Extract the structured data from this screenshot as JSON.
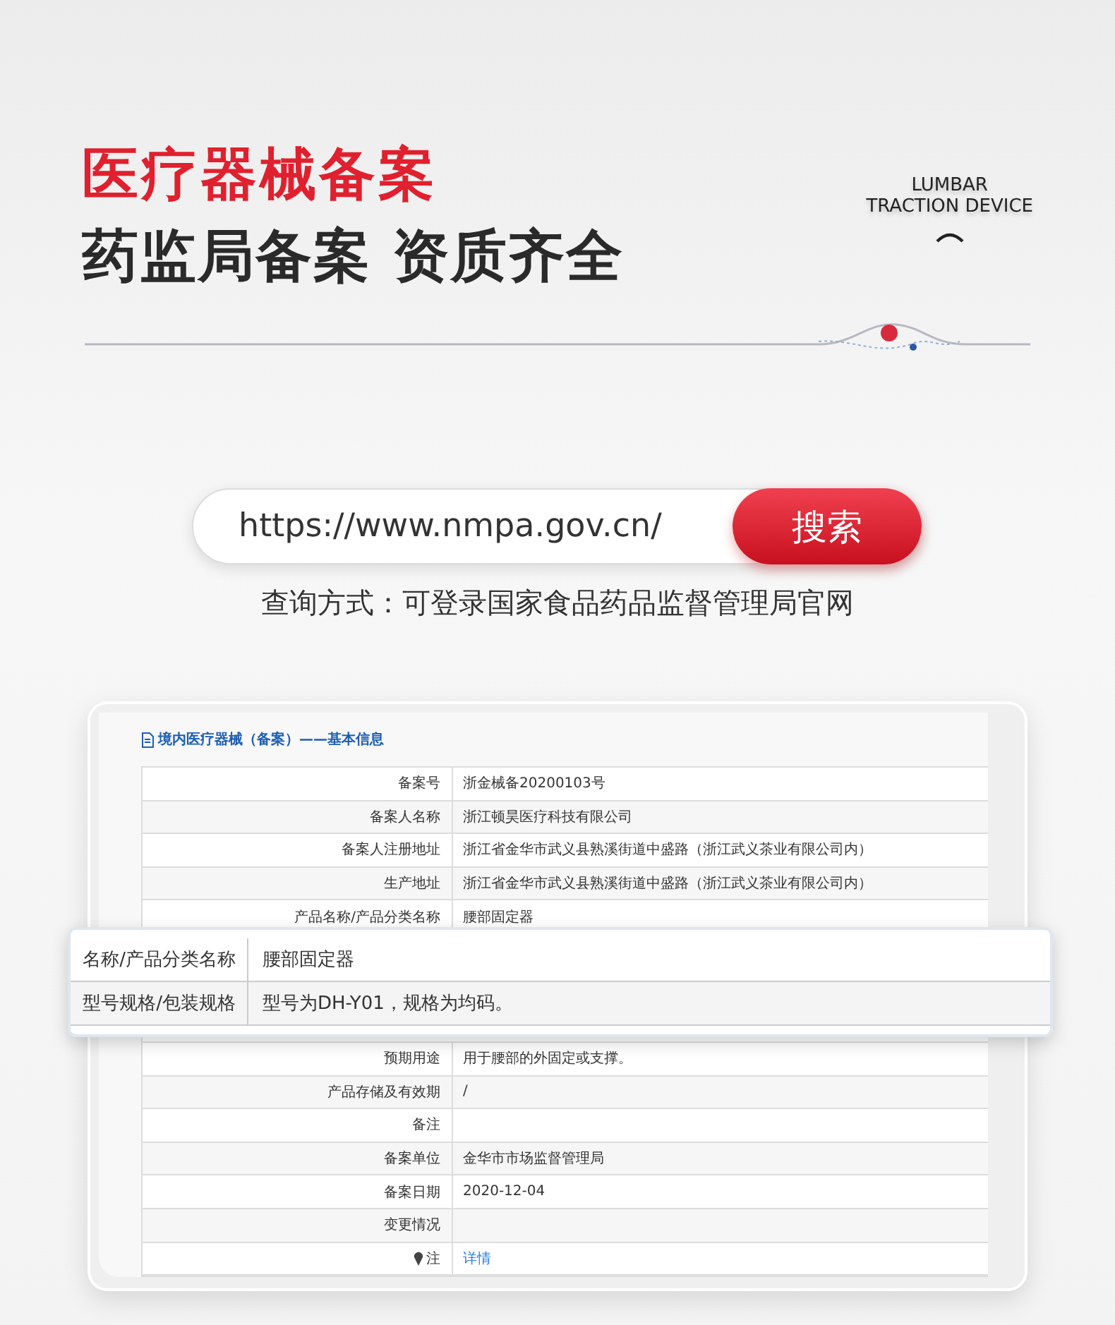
{
  "header": {
    "title": "医疗器械备案",
    "subtitle": "药监局备案 资质齐全",
    "badge_lines": [
      "LUMBAR",
      "TRACTION DEVICE"
    ]
  },
  "search": {
    "value": "https://www.nmpa.gov.cn/",
    "button": "搜索",
    "caption": "查询方式：可登录国家食品药品监督管理局官网"
  },
  "record": {
    "title": "境内医疗器械（备案）——基本信息",
    "rows": [
      {
        "kind": "text",
        "label": "备案号",
        "value": "浙金械备20200103号"
      },
      {
        "kind": "text",
        "label": "备案人名称",
        "value": "浙江顿昊医疗科技有限公司"
      },
      {
        "kind": "text",
        "label": "备案人注册地址",
        "value": "浙江省金华市武义县熟溪街道中盛路（浙江武义茶业有限公司内）"
      },
      {
        "kind": "text",
        "label": "生产地址",
        "value": "浙江省金华市武义县熟溪街道中盛路（浙江武义茶业有限公司内）"
      },
      {
        "kind": "text",
        "label": "产品名称/产品分类名称",
        "value": "腰部固定器"
      },
      {
        "kind": "covered"
      },
      {
        "kind": "text",
        "label": "预期用途",
        "value": "用于腰部的外固定或支撑。"
      },
      {
        "kind": "text",
        "label": "产品存储及有效期",
        "value": "/"
      },
      {
        "kind": "text",
        "label": "备注"
      },
      {
        "kind": "text",
        "label": "备案单位",
        "value": "金华市市场监督管理局"
      },
      {
        "kind": "text",
        "label": "备案日期",
        "value": "2020-12-04"
      },
      {
        "kind": "text",
        "label": "变更情况"
      },
      {
        "kind": "link",
        "label": "注",
        "value": "详情"
      }
    ],
    "magnified_rows": [
      {
        "label": "名称/产品分类名称",
        "value": "腰部固定器"
      },
      {
        "label": "型号规格/包装规格",
        "value": "型号为DH-Y01，规格为均码。"
      }
    ]
  }
}
